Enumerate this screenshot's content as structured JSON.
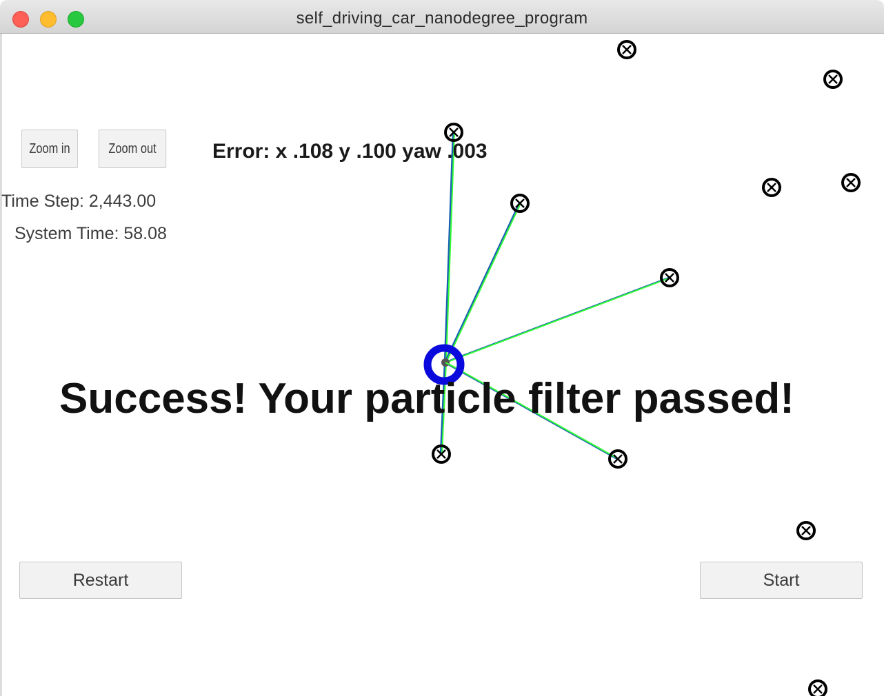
{
  "window": {
    "title": "self_driving_car_nanodegree_program"
  },
  "controls": {
    "zoom_in_label": "Zoom in",
    "zoom_out_label": "Zoom out",
    "restart_label": "Restart",
    "start_label": "Start"
  },
  "readouts": {
    "time_step": "Time Step: 2,443.00",
    "system_time": "System Time: 58.08",
    "error": "Error: x .108 y .100 yaw .003"
  },
  "status": {
    "message": "Success! Your particle filter passed!"
  },
  "colors": {
    "vehicle": "#0a0adc",
    "observation_line": "#33ff33",
    "association_line": "#1a5fb4",
    "landmark": "#000000"
  },
  "icons": {
    "landmark": "landmark-marker-icon",
    "vehicle": "vehicle-marker-icon"
  }
}
